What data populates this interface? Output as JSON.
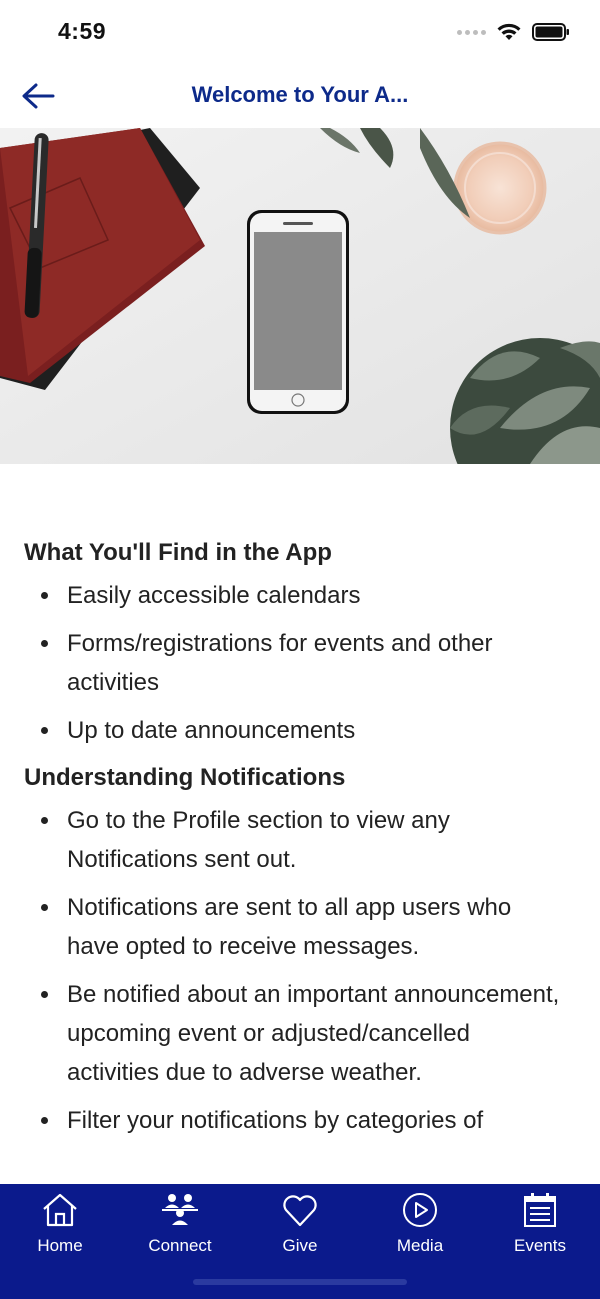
{
  "status_bar": {
    "time": "4:59"
  },
  "header": {
    "title": "Welcome to Your A..."
  },
  "hero": {
    "image_alt": ""
  },
  "sections": [
    {
      "heading": "What You'll Find in the App",
      "items": [
        "Easily accessible calendars",
        "Forms/registrations for events and other activities",
        "Up to date announcements"
      ]
    },
    {
      "heading": "Understanding Notifications",
      "items": [
        "Go to the Profile section to view any Notifications sent out.",
        "Notifications are sent to all app users who have opted to receive messages.",
        "Be notified about an important announcement, upcoming event or adjusted/cancelled activities due to adverse weather.",
        "Filter your notifications by categories of"
      ]
    }
  ],
  "tab_bar": {
    "background": "#0b1a8c",
    "tabs": [
      {
        "label": "Home",
        "icon": "home-icon"
      },
      {
        "label": "Connect",
        "icon": "people-icon"
      },
      {
        "label": "Give",
        "icon": "heart-icon"
      },
      {
        "label": "Media",
        "icon": "play-icon"
      },
      {
        "label": "Events",
        "icon": "calendar-icon"
      }
    ]
  },
  "colors": {
    "accent": "#0d2a8a",
    "tab_bar": "#0b1a8c"
  }
}
